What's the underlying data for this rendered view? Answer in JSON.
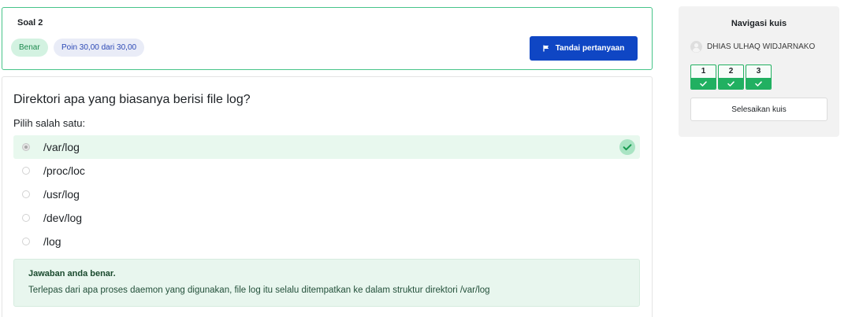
{
  "question_info": {
    "title": "Soal 2",
    "status_badge": "Benar",
    "points_badge": "Poin 30,00 dari 30,00",
    "flag_button": {
      "label": "Tandai pertanyaan",
      "icon": "flag-icon"
    }
  },
  "question": {
    "text": "Direktori apa yang biasanya berisi file log?",
    "prompt": "Pilih salah satu:",
    "options": [
      {
        "label": "/var/log",
        "selected": true,
        "correct": true
      },
      {
        "label": "/proc/loc",
        "selected": false,
        "correct": false
      },
      {
        "label": "/usr/log",
        "selected": false,
        "correct": false
      },
      {
        "label": "/dev/log",
        "selected": false,
        "correct": false
      },
      {
        "label": "/log",
        "selected": false,
        "correct": false
      }
    ],
    "correct_icon": "check-circle-icon"
  },
  "feedback": {
    "title": "Jawaban anda benar.",
    "explanation": "Terlepas dari apa proses daemon yang digunakan, file log itu selalu ditempatkan ke dalam struktur direktori /var/log"
  },
  "navigation": {
    "title": "Navigasi kuis",
    "user": {
      "name": "DHIAS ULHAQ WIDJARNAKO",
      "avatar_icon": "user-avatar-icon"
    },
    "questions": [
      {
        "number": "1",
        "correct": true
      },
      {
        "number": "2",
        "correct": true
      },
      {
        "number": "3",
        "correct": true
      }
    ],
    "finish_button": "Selesaikan kuis"
  },
  "colors": {
    "accent": "#0f46c4",
    "success": "#21b061",
    "success_light": "#e8f8ee",
    "card_border_success": "#47c489",
    "sidebar_bg": "#f2f2f2"
  }
}
